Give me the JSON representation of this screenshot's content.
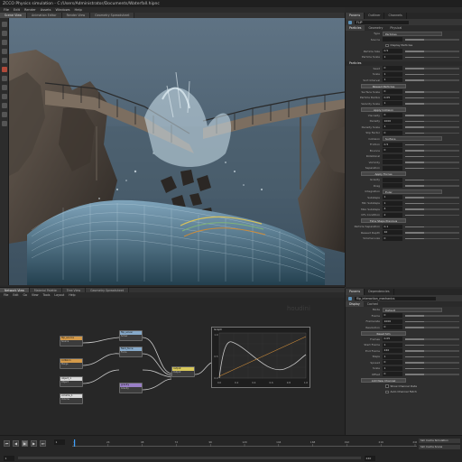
{
  "window": {
    "title": "ZCCO Physics simulation - C:/Users/Administrator/Documents/Waterfall.hipnc"
  },
  "menu": [
    "File",
    "Edit",
    "Render",
    "Assets",
    "Windows",
    "Help"
  ],
  "viewport_tabs": [
    "Scene View",
    "Animation Editor",
    "Render View",
    "Geometry Spreadsheet"
  ],
  "colors": {
    "bg": "#2a2a2a",
    "panel": "#2f2f2f",
    "accent": "#5a8fb6",
    "node_orange": "#d49a4a",
    "node_white": "#d9d9d9",
    "node_blue": "#86a9c9",
    "node_purple": "#9a7fc7",
    "node_yellow": "#d8c85a",
    "curve_gray": "#c9c9c9",
    "curve_orange": "#c98a3a"
  },
  "toolbox_icons": [
    "select-icon",
    "move-icon",
    "rotate-icon",
    "scale-icon",
    "brush-icon",
    "paint-icon",
    "handle-icon",
    "view-icon",
    "camera-icon",
    "light-icon",
    "pose-icon",
    "flipbook-icon"
  ],
  "params": {
    "tabs": [
      "Params",
      "Outliner",
      "Channels"
    ],
    "node_name": "FLIP",
    "sub_tabs": [
      "Particles",
      "Geometry",
      "Physical"
    ],
    "rows": [
      {
        "kind": "dropdown",
        "label": "Type",
        "value": "Particles"
      },
      {
        "kind": "field",
        "label": "Source",
        "value": ""
      },
      {
        "kind": "checkbox",
        "label": "Display Particles"
      },
      {
        "kind": "field",
        "label": "Particle Size",
        "value": "0.5"
      },
      {
        "kind": "field",
        "label": "Particle Scale",
        "value": "1"
      },
      {
        "kind": "section",
        "label": "Particles"
      },
      {
        "kind": "field",
        "label": "Seed",
        "value": "0"
      },
      {
        "kind": "field",
        "label": "Scale",
        "value": "1"
      },
      {
        "kind": "field",
        "label": "Sort Interval",
        "value": "1"
      },
      {
        "kind": "button",
        "label": "Reseed Particles"
      },
      {
        "kind": "field",
        "label": "Surface Scale",
        "value": "0"
      },
      {
        "kind": "field",
        "label": "Particle Radius",
        "value": "0.05"
      },
      {
        "kind": "field",
        "label": "Velocity Scale",
        "value": "1"
      },
      {
        "kind": "button",
        "label": "Apply Collision"
      },
      {
        "kind": "field",
        "label": "Viscosity",
        "value": "0"
      },
      {
        "kind": "field",
        "label": "Density",
        "value": "1000"
      },
      {
        "kind": "field",
        "label": "Density Scale",
        "value": "1"
      },
      {
        "kind": "field",
        "label": "Slip Factor",
        "value": "0"
      },
      {
        "kind": "dropdown",
        "label": "Collision",
        "value": "Surface"
      },
      {
        "kind": "field",
        "label": "Friction",
        "value": "0.5"
      },
      {
        "kind": "field",
        "label": "Bounce",
        "value": "0"
      },
      {
        "kind": "field",
        "label": "Rotational",
        "value": ""
      },
      {
        "kind": "field",
        "label": "Vorticity",
        "value": ""
      },
      {
        "kind": "field",
        "label": "Separation",
        "value": ""
      },
      {
        "kind": "button",
        "label": "Apply Forces"
      },
      {
        "kind": "field",
        "label": "Gravity",
        "value": ""
      },
      {
        "kind": "field",
        "label": "Drag",
        "value": ""
      },
      {
        "kind": "dropdown",
        "label": "Integration",
        "value": "Euler"
      },
      {
        "kind": "field",
        "label": "Substeps",
        "value": "1"
      },
      {
        "kind": "field",
        "label": "Min Substeps",
        "value": "1"
      },
      {
        "kind": "field",
        "label": "Max Substeps",
        "value": "4"
      },
      {
        "kind": "field",
        "label": "CFL Condition",
        "value": "2"
      },
      {
        "kind": "button",
        "label": "Time Steps Previous"
      },
      {
        "kind": "field",
        "label": "Particle Separation",
        "value": "0.1"
      },
      {
        "kind": "field",
        "label": "Reseed Depth",
        "value": "10"
      },
      {
        "kind": "field",
        "label": "Volume Loss",
        "value": "0"
      }
    ]
  },
  "params2": {
    "tabs": [
      "Params",
      "Dependencies"
    ],
    "node_name": "flip_interaction_mechanics",
    "sub_tabs": [
      "Display",
      "Cached"
    ],
    "rows": [
      {
        "kind": "dropdown",
        "label": "Mode",
        "value": "Default"
      },
      {
        "kind": "field",
        "label": "Frame",
        "value": "0"
      },
      {
        "kind": "field",
        "label": "Framerate",
        "value": "1000"
      },
      {
        "kind": "field",
        "label": "Resolution",
        "value": "0"
      },
      {
        "kind": "button",
        "label": "Reset Sim"
      },
      {
        "kind": "field",
        "label": "Frames",
        "value": "0.05"
      },
      {
        "kind": "field",
        "label": "Start Frame",
        "value": "1"
      },
      {
        "kind": "field",
        "label": "End Frame",
        "value": "240"
      },
      {
        "kind": "field",
        "label": "Steps",
        "value": "1"
      },
      {
        "kind": "field",
        "label": "Spread",
        "value": "0"
      },
      {
        "kind": "field",
        "label": "Scale",
        "value": "1"
      },
      {
        "kind": "field",
        "label": "Offset",
        "value": "0"
      },
      {
        "kind": "button",
        "label": "Add New Channel"
      },
      {
        "kind": "checkbox",
        "label": "Show Channel Data"
      },
      {
        "kind": "checkbox",
        "label": "Auto Channel Fetch"
      }
    ]
  },
  "network": {
    "tabs": [
      "Network View",
      "Material Palette",
      "Tree View",
      "Geometry Spreadsheet"
    ],
    "menu": [
      "File",
      "Edit",
      "Go",
      "View",
      "Tools",
      "Layout",
      "Help"
    ],
    "watermark": "houdini",
    "nodes": [
      {
        "name": "flip_source",
        "type": "Source",
        "color": "#d49a4a"
      },
      {
        "name": "collision",
        "type": "Merge",
        "color": "#d49a4a"
      },
      {
        "name": "object_1",
        "type": "Object",
        "color": "#d9d9d9"
      },
      {
        "name": "volume_1",
        "type": "Volume",
        "color": "#d9d9d9"
      },
      {
        "name": "flip_solver",
        "type": "Solver",
        "color": "#86a9c9"
      },
      {
        "name": "field_force",
        "type": "Force",
        "color": "#86a9c9"
      },
      {
        "name": "gravity",
        "type": "Gravity",
        "color": "#9a7fc7"
      },
      {
        "name": "output",
        "type": "Output",
        "color": "#d8c85a"
      }
    ],
    "graph": {
      "title": "Graph",
      "x_ticks": [
        "0.0",
        "0.2",
        "0.4",
        "0.6",
        "0.8",
        "1.0"
      ],
      "y_ticks": [
        "0.0",
        "0.5",
        "1.0"
      ]
    }
  },
  "timeline": {
    "current_frame": "1",
    "start": "1",
    "end": "240",
    "ticks": [
      "1",
      "24",
      "48",
      "72",
      "96",
      "120",
      "144",
      "168",
      "192",
      "216",
      "240"
    ],
    "right_buttons": [
      "Sim Cache Simulation",
      "Sim Cache Scene"
    ]
  }
}
